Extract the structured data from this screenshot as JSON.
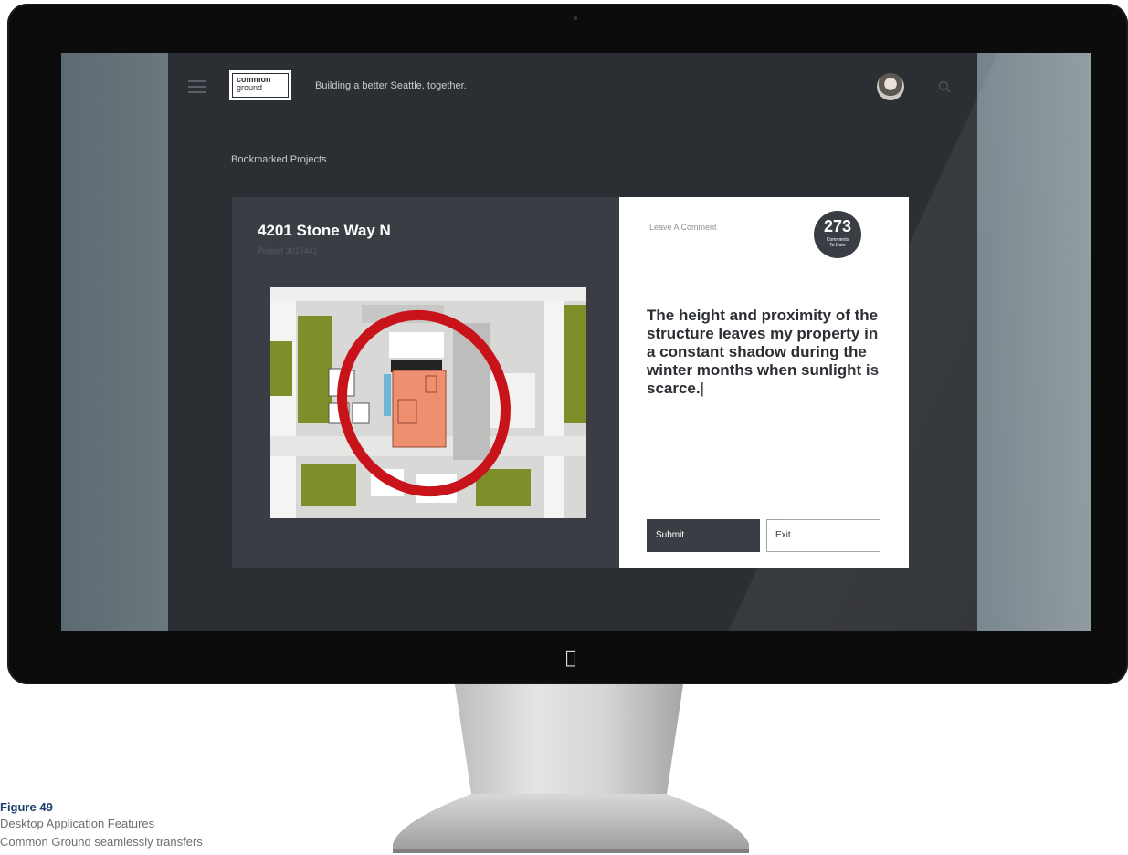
{
  "header": {
    "logo_line1": "common",
    "logo_line2": "ground",
    "tagline": "Building a better Seattle, together."
  },
  "section_title": "Bookmarked Projects",
  "project": {
    "title": "4201 Stone Way N",
    "id": "Project 3015441"
  },
  "comment": {
    "label": "Leave A Comment",
    "count": "273",
    "count_caption_line1": "Comments",
    "count_caption_line2": "To Date",
    "text": "The height and proximity of the structure leaves my property in a constant shadow during the winter months when sunlight is scarce.",
    "submit_label": "Submit",
    "exit_label": "Exit"
  },
  "caption": {
    "figure": "Figure 49",
    "line1": "Desktop Application Features",
    "line2": "Common Ground seamlessly transfers"
  },
  "colors": {
    "app_bg": "#2b2e33",
    "card_bg": "#3a3e44",
    "highlight_red": "#c8131b",
    "building_orange": "#ee8f6f",
    "park_green": "#7e8f2a",
    "caption_blue": "#1f3f6f"
  },
  "icons": {
    "menu": "hamburger-icon",
    "search": "search-icon",
    "logo_device": "apple-logo-icon"
  }
}
